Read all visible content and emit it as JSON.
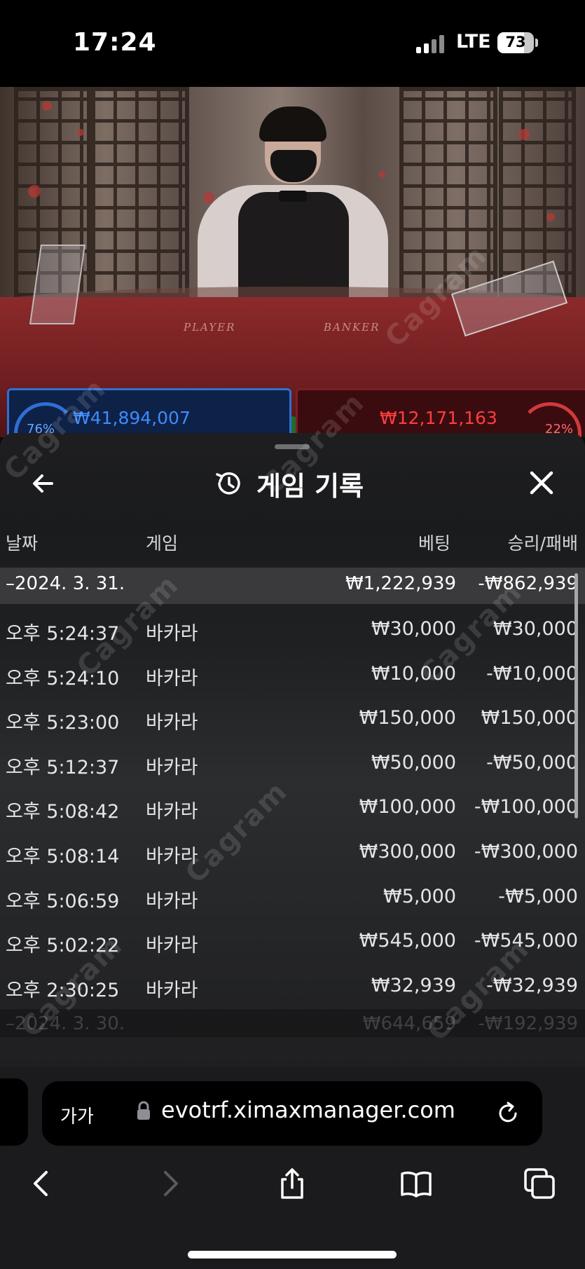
{
  "status_bar": {
    "time": "17:24",
    "network": "LTE",
    "battery": "73"
  },
  "video": {
    "player_label": "PLAYER",
    "banker_label": "BANKER",
    "player_bet": "₩41,894,007",
    "banker_bet": "₩12,171,163",
    "player_pct": "76%",
    "banker_pct": "22%"
  },
  "panel": {
    "title": "게임 기록",
    "columns": {
      "date": "날짜",
      "game": "게임",
      "bet": "베팅",
      "result": "승리/패배"
    },
    "summary": {
      "date": "–2024. 3. 31.",
      "bet": "₩1,222,939",
      "result": "-₩862,939"
    },
    "rows": [
      {
        "time": "오후 5:24:37",
        "game": "바카라",
        "bet": "₩30,000",
        "result": "₩30,000"
      },
      {
        "time": "오후 5:24:10",
        "game": "바카라",
        "bet": "₩10,000",
        "result": "-₩10,000"
      },
      {
        "time": "오후 5:23:00",
        "game": "바카라",
        "bet": "₩150,000",
        "result": "₩150,000"
      },
      {
        "time": "오후 5:12:37",
        "game": "바카라",
        "bet": "₩50,000",
        "result": "-₩50,000"
      },
      {
        "time": "오후 5:08:42",
        "game": "바카라",
        "bet": "₩100,000",
        "result": "-₩100,000"
      },
      {
        "time": "오후 5:08:14",
        "game": "바카라",
        "bet": "₩300,000",
        "result": "-₩300,000"
      },
      {
        "time": "오후 5:06:59",
        "game": "바카라",
        "bet": "₩5,000",
        "result": "-₩5,000"
      },
      {
        "time": "오후 5:02:22",
        "game": "바카라",
        "bet": "₩545,000",
        "result": "-₩545,000"
      },
      {
        "time": "오후 2:30:25",
        "game": "바카라",
        "bet": "₩32,939",
        "result": "-₩32,939"
      }
    ],
    "next_summary": {
      "date": "–2024. 3. 30.",
      "bet": "₩644,659",
      "result": "-₩192,939"
    }
  },
  "watermark": "Cagram",
  "browser": {
    "text_size_label": "가가",
    "url": "evotrf.ximaxmanager.com"
  },
  "colors": {
    "player_blue": "#2f6fd6",
    "banker_red": "#d23a3a",
    "panel_bg": "#1e1e20"
  }
}
